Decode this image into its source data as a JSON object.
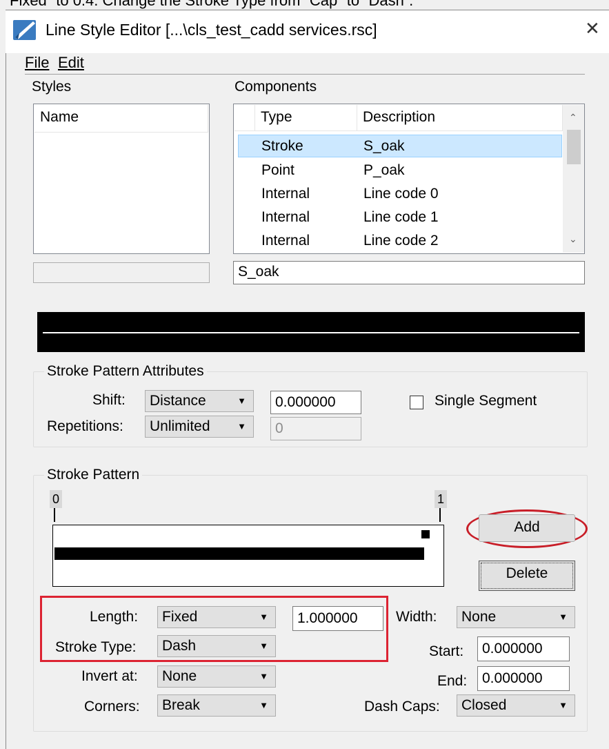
{
  "caption": "Fixed” to 0.4. Change the Stroke Type from “Cap” to “Dash”.",
  "window": {
    "title": "Line Style Editor [...\\cls_test_cadd services.rsc]",
    "close": "✕"
  },
  "menu": {
    "file": "File",
    "edit": "Edit"
  },
  "styles": {
    "label": "Styles",
    "header_name": "Name",
    "name_value": ""
  },
  "components": {
    "label": "Components",
    "headers": {
      "type": "Type",
      "description": "Description"
    },
    "rows": [
      {
        "type": "Stroke",
        "description": "S_oak"
      },
      {
        "type": "Point",
        "description": "P_oak"
      },
      {
        "type": "Internal",
        "description": "Line code 0"
      },
      {
        "type": "Internal",
        "description": "Line code 1"
      },
      {
        "type": "Internal",
        "description": "Line code 2"
      }
    ],
    "selected_index": 0,
    "description_value": "S_oak"
  },
  "attributes": {
    "group_title": "Stroke Pattern Attributes",
    "shift_label": "Shift:",
    "shift_value": "Distance",
    "shift_amount": "0.000000",
    "repetitions_label": "Repetitions:",
    "repetitions_value": "Unlimited",
    "repetitions_amount": "0",
    "single_segment_label": "Single Segment",
    "single_segment_checked": false
  },
  "pattern": {
    "group_title": "Stroke Pattern",
    "ruler_start": "0",
    "ruler_end": "1",
    "add_label": "Add",
    "delete_label": "Delete",
    "length_label": "Length:",
    "length_value": "Fixed",
    "length_amount": "1.000000",
    "stroke_type_label": "Stroke Type:",
    "stroke_type_value": "Dash",
    "invert_label": "Invert at:",
    "invert_value": "None",
    "corners_label": "Corners:",
    "corners_value": "Break",
    "width_label": "Width:",
    "width_value": "None",
    "start_label": "Start:",
    "start_value": "0.000000",
    "end_label": "End:",
    "end_value": "0.000000",
    "dash_caps_label": "Dash Caps:",
    "dash_caps_value": "Closed"
  },
  "colors": {
    "highlight": "#dc2332",
    "selection": "#cce8ff"
  }
}
